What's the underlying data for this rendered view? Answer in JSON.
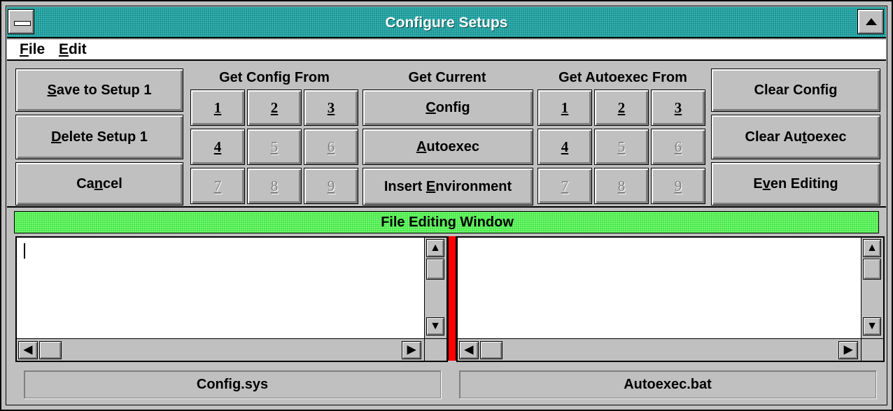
{
  "window": {
    "title": "Configure Setups",
    "colors": {
      "title_bar": "#0f8a8a",
      "editing_bar": "#3ae23a",
      "divider": "#ff0000",
      "face": "#c0c0c0"
    }
  },
  "titlebar": {
    "system_menu_icon": "system-menu-icon",
    "maximize_icon": "maximize-arrow-icon"
  },
  "menu": {
    "file": {
      "prefix": "",
      "hot": "F",
      "rest": "ile"
    },
    "edit": {
      "prefix": "",
      "hot": "E",
      "rest": "dit"
    }
  },
  "left_buttons": {
    "save": {
      "prefix": "",
      "hot": "S",
      "rest": "ave to Setup 1"
    },
    "delete": {
      "prefix": "",
      "hot": "D",
      "rest": "elete Setup 1"
    },
    "cancel": {
      "prefix": "Ca",
      "hot": "n",
      "rest": "cel"
    }
  },
  "get_config_from": {
    "header": "Get Config From",
    "buttons": [
      {
        "label": "1",
        "enabled": true
      },
      {
        "label": "2",
        "enabled": true
      },
      {
        "label": "3",
        "enabled": true
      },
      {
        "label": "4",
        "enabled": true
      },
      {
        "label": "5",
        "enabled": false
      },
      {
        "label": "6",
        "enabled": false
      },
      {
        "label": "7",
        "enabled": false
      },
      {
        "label": "8",
        "enabled": false
      },
      {
        "label": "9",
        "enabled": false
      }
    ]
  },
  "get_current": {
    "header": "Get Current",
    "config": {
      "prefix": "",
      "hot": "C",
      "rest": "onfig"
    },
    "autoexec": {
      "prefix": "",
      "hot": "A",
      "rest": "utoexec"
    },
    "insert_env": {
      "prefix": "Insert ",
      "hot": "E",
      "rest": "nvironment"
    }
  },
  "get_autoexec_from": {
    "header": "Get Autoexec From",
    "buttons": [
      {
        "label": "1",
        "enabled": true
      },
      {
        "label": "2",
        "enabled": true
      },
      {
        "label": "3",
        "enabled": true
      },
      {
        "label": "4",
        "enabled": true
      },
      {
        "label": "5",
        "enabled": false
      },
      {
        "label": "6",
        "enabled": false
      },
      {
        "label": "7",
        "enabled": false
      },
      {
        "label": "8",
        "enabled": false
      },
      {
        "label": "9",
        "enabled": false
      }
    ]
  },
  "right_buttons": {
    "clear_config": {
      "prefix": "Clear Confi",
      "hot": "g",
      "rest": ""
    },
    "clear_autoexec": {
      "prefix": "Clear Au",
      "hot": "t",
      "rest": "oexec"
    },
    "even_editing": {
      "prefix": "E",
      "hot": "v",
      "rest": "en Editing"
    }
  },
  "editing": {
    "title": "File Editing Window",
    "config_text": "",
    "autoexec_text": ""
  },
  "status": {
    "left": "Config.sys",
    "right": "Autoexec.bat"
  },
  "scroll_icons": {
    "up": "▲",
    "down": "▼",
    "left": "◀",
    "right": "▶"
  }
}
